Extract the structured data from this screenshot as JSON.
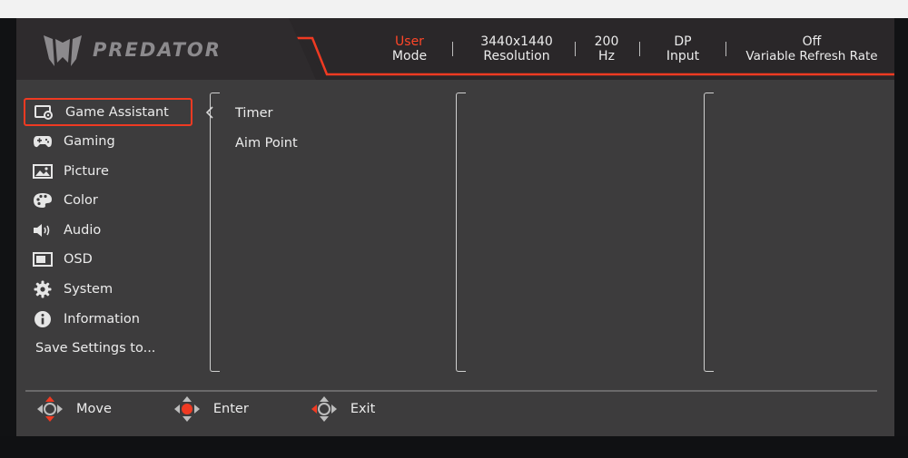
{
  "brand": "PREDATOR",
  "status": [
    {
      "line1": "User",
      "line2": "Mode",
      "highlight": true
    },
    {
      "line1": "3440x1440",
      "line2": "Resolution",
      "highlight": false
    },
    {
      "line1": "200",
      "line2": "Hz",
      "highlight": false
    },
    {
      "line1": "DP",
      "line2": "Input",
      "highlight": false
    },
    {
      "line1": "Off",
      "line2": "Variable Refresh Rate",
      "highlight": false
    }
  ],
  "sidebar": {
    "items": [
      {
        "label": "Game Assistant",
        "icon": "game-assistant-icon",
        "selected": true
      },
      {
        "label": "Gaming",
        "icon": "gamepad-icon",
        "selected": false
      },
      {
        "label": "Picture",
        "icon": "picture-icon",
        "selected": false
      },
      {
        "label": "Color",
        "icon": "palette-icon",
        "selected": false
      },
      {
        "label": "Audio",
        "icon": "speaker-icon",
        "selected": false
      },
      {
        "label": "OSD",
        "icon": "osd-icon",
        "selected": false
      },
      {
        "label": "System",
        "icon": "gear-icon",
        "selected": false
      },
      {
        "label": "Information",
        "icon": "info-icon",
        "selected": false
      },
      {
        "label": "Save Settings to...",
        "icon": "",
        "selected": false
      }
    ]
  },
  "submenu": {
    "items": [
      "Timer",
      "Aim Point"
    ]
  },
  "footer": {
    "move": "Move",
    "enter": "Enter",
    "exit": "Exit"
  },
  "colors": {
    "accent": "#ef3a22",
    "panel": "#3d3c3d",
    "header": "#2a2729"
  }
}
